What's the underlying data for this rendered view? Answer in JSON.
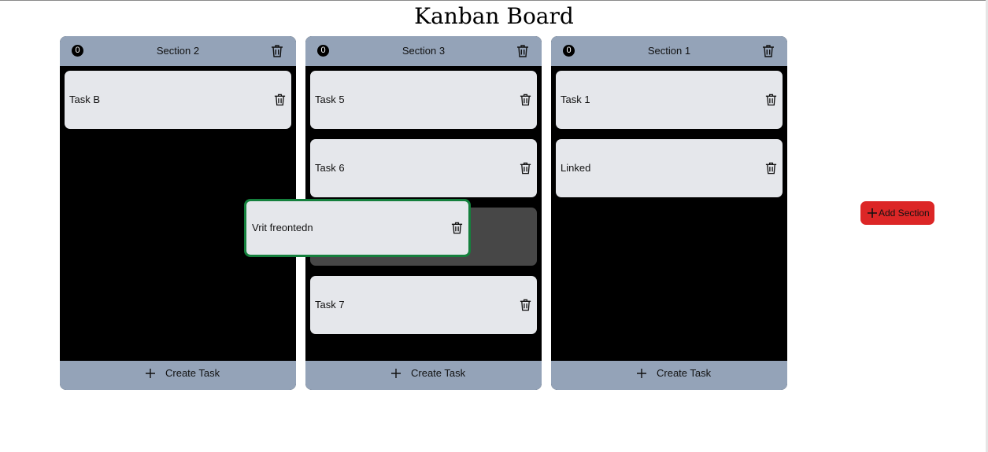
{
  "board": {
    "title": "Kanban Board",
    "add_section_label": "Add Section",
    "accent_color": "#dc2626"
  },
  "sections": [
    {
      "title": "Section 2",
      "count": "0",
      "create_label": "Create Task",
      "tasks": [
        {
          "label": "Task B"
        }
      ]
    },
    {
      "title": "Section 3",
      "count": "0",
      "create_label": "Create Task",
      "tasks": [
        {
          "label": "Task 5"
        },
        {
          "label": "Task 6"
        },
        {
          "label": "Task 7"
        }
      ]
    },
    {
      "title": "Section 1",
      "count": "0",
      "create_label": "Create Task",
      "tasks": [
        {
          "label": "Task 1"
        },
        {
          "label": "Linked"
        }
      ]
    }
  ],
  "dragging_task": {
    "label": "Vrit freontedn"
  },
  "icons": {
    "trash": "trash-icon",
    "plus": "plus-icon"
  },
  "colors": {
    "header": "#94a3b8",
    "card": "#e5e7eb",
    "drag_border": "#15803d",
    "placeholder": "#474747"
  }
}
